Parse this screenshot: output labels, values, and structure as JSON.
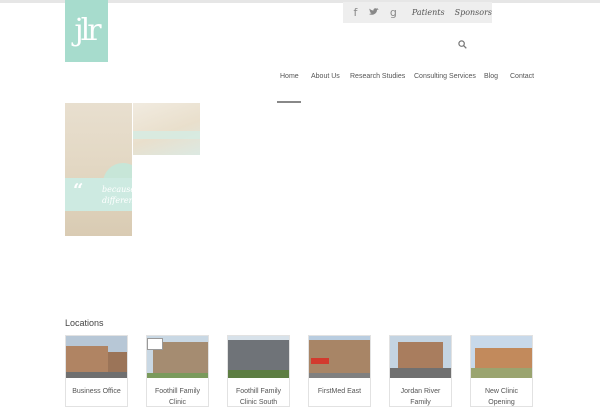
{
  "logo": {
    "text": "jlr"
  },
  "utility": {
    "social_icons": [
      "facebook-icon",
      "twitter-icon",
      "google-plus-icon"
    ],
    "social_glyphs": [
      "f",
      "🐦",
      "g"
    ],
    "links": [
      "Patients",
      "Sponsors"
    ]
  },
  "nav": {
    "items": [
      "Home",
      "About Us",
      "Research Studies",
      "Consulting Services",
      "Blog",
      "Contact"
    ],
    "active": "Home"
  },
  "hero": {
    "quote_line1": "because",
    "quote_line2": "different"
  },
  "locations": {
    "heading": "Locations",
    "cards": [
      {
        "label": "Business Office"
      },
      {
        "label": "Foothill Family Clinic"
      },
      {
        "label": "Foothill Family Clinic South"
      },
      {
        "label": "FirstMed East"
      },
      {
        "label": "Jordan River Family"
      },
      {
        "label": "New Clinic Opening"
      }
    ]
  },
  "colors": {
    "brand": "#a7dccd",
    "bar": "#eeeeee"
  }
}
